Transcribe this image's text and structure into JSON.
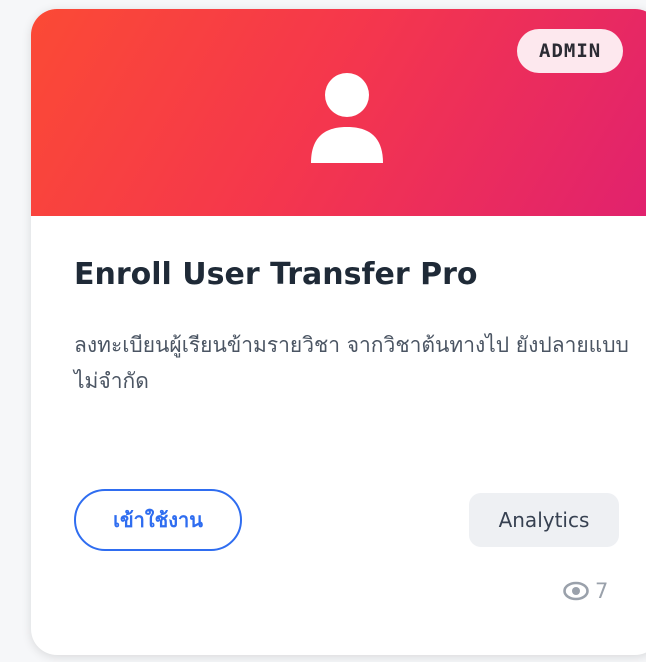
{
  "card": {
    "badge": "ADMIN",
    "title": "Enroll User Transfer Pro",
    "description": "ลงทะเบียนผู้เรียนข้ามรายวิชา จากวิชาต้นทางไป ยังปลายแบบไม่จำกัด",
    "enter_button_label": "เข้าใช้งาน",
    "tag": "Analytics",
    "views": "7",
    "icons": {
      "hero": "user-icon",
      "views": "eye-icon"
    },
    "colors": {
      "hero_gradient_start": "#fb4a35",
      "hero_gradient_end": "#e0216f",
      "accent": "#2f6df0",
      "badge_bg": "#fde8ee"
    }
  }
}
